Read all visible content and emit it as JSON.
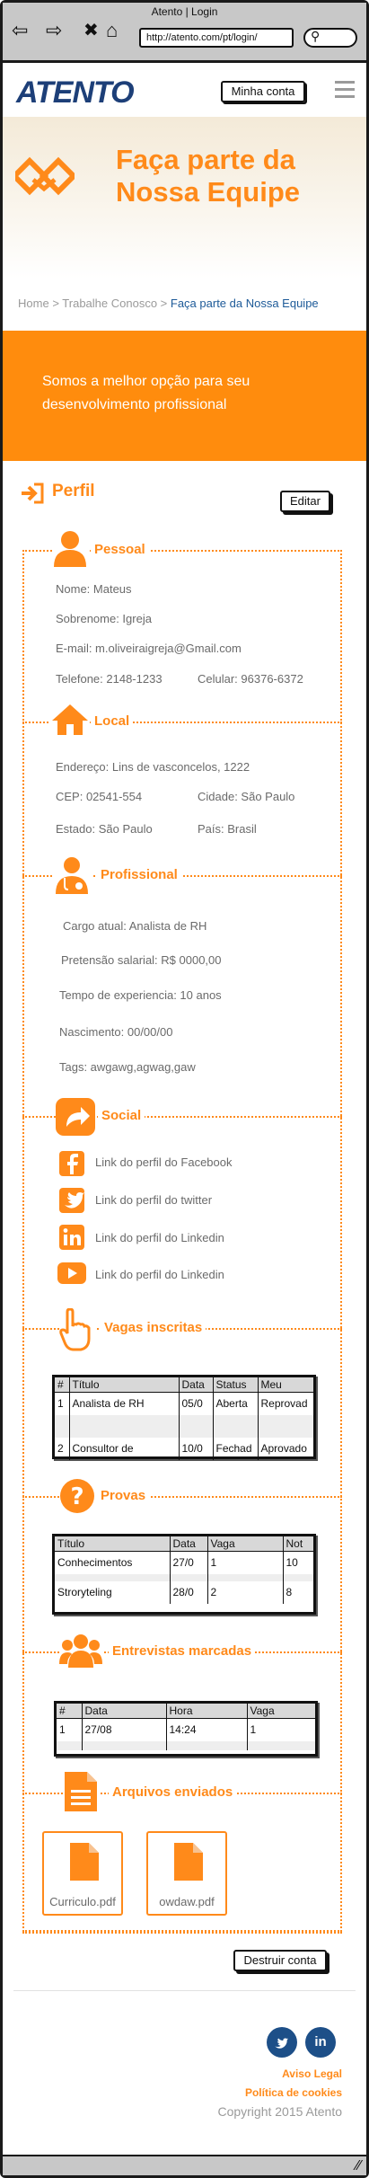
{
  "browser": {
    "title": "Atento | Login",
    "url": "http://atento.com/pt/login/"
  },
  "header": {
    "logo": "ATENTO",
    "account_label": "Minha conta"
  },
  "hero": {
    "title": "Faça parte da Nossa Equipe"
  },
  "breadcrumb": {
    "items": [
      "Home",
      "Trabalhe Conosco"
    ],
    "current": "Faça parte da Nossa Equipe",
    "separator": ">"
  },
  "banner": {
    "text": "Somos a melhor opção para seu desenvolvimento profissional"
  },
  "profile": {
    "title": "Perfil",
    "edit_label": "Editar",
    "destroy_label": "Destruir conta"
  },
  "pessoal": {
    "heading": "Pessoal",
    "nome": "Nome: Mateus",
    "sobrenome": "Sobrenome: Igreja",
    "email": "E-mail: m.oliveiraigreja@Gmail.com",
    "telefone": "Telefone: 2148-1233",
    "celular": "Celular: 96376-6372"
  },
  "local": {
    "heading": "Local",
    "endereco": "Endereço: Lins de vasconcelos, 1222",
    "cep": "CEP: 02541-554",
    "cidade": "Cidade: São Paulo",
    "estado": "Estado: São Paulo",
    "pais": "País: Brasil"
  },
  "profissional": {
    "heading": "Profissional",
    "cargo": "Cargo atual: Analista de RH",
    "pretensao": "Pretensão salarial: R$ 0000,00",
    "tempo": "Tempo de experiencia: 10 anos",
    "nascimento": "Nascimento: 00/00/00",
    "tags": "Tags: awgawg,agwag,gaw"
  },
  "social": {
    "heading": "Social",
    "links": [
      "Link do perfil do Facebook",
      "Link do perfil do twitter",
      "Link do perfil do Linkedin",
      "Link do perfil do Linkedin"
    ]
  },
  "vagas": {
    "heading": "Vagas inscritas",
    "columns": [
      "#",
      "Título",
      "Data",
      "Status",
      "Meu"
    ],
    "rows": [
      [
        "1",
        "Analista de RH",
        "05/0",
        "Aberta",
        "Reprovad"
      ],
      [
        "2",
        "Consultor de",
        "10/0",
        "Fechad",
        "Aprovado"
      ]
    ]
  },
  "provas": {
    "heading": "Provas",
    "columns": [
      "Título",
      "Data",
      "Vaga",
      "Not"
    ],
    "rows": [
      [
        "Conhecimentos",
        "27/0",
        "1",
        "10"
      ],
      [
        "Stroryteling",
        "28/0",
        "2",
        "8"
      ]
    ]
  },
  "entrevistas": {
    "heading": "Entrevistas marcadas",
    "columns": [
      "#",
      "Data",
      "Hora",
      "Vaga"
    ],
    "rows": [
      [
        "1",
        "27/08",
        "14:24",
        "1"
      ]
    ]
  },
  "arquivos": {
    "heading": "Arquivos enviados",
    "files": [
      "Curriculo.pdf",
      "owdaw.pdf"
    ]
  },
  "footer": {
    "social": [
      "twitter",
      "linkedin"
    ],
    "aviso": "Aviso Legal",
    "cookies": "Política de cookies",
    "copyright": "Copyright 2015 Atento"
  },
  "colors": {
    "accent": "#ff8a1a",
    "brand": "#1d3f78",
    "text": "#6a6a6a"
  }
}
